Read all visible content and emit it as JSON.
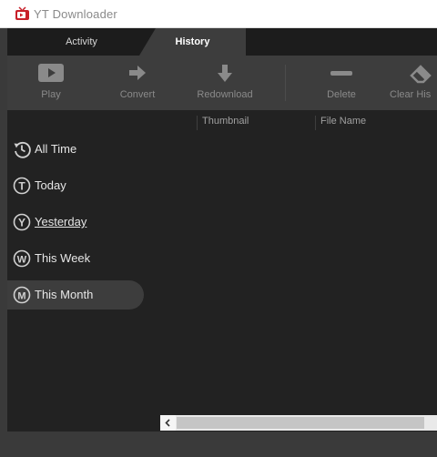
{
  "window": {
    "title": "YT Downloader",
    "icon": "tv-app-icon"
  },
  "tabs": [
    {
      "label": "Activity",
      "selected": false
    },
    {
      "label": "History",
      "selected": true
    }
  ],
  "toolbar": {
    "play": {
      "label": "Play",
      "icon": "play-icon"
    },
    "convert": {
      "label": "Convert",
      "icon": "arrow-right-icon"
    },
    "redownload": {
      "label": "Redownload",
      "icon": "arrow-down-icon"
    },
    "delete": {
      "label": "Delete",
      "icon": "minus-icon"
    },
    "clear_history": {
      "label": "Clear His",
      "icon": "eraser-icon"
    }
  },
  "sidebar": {
    "items": [
      {
        "label": "All Time",
        "icon": "clock-history-icon",
        "letter": "",
        "selected": false
      },
      {
        "label": "Today",
        "icon": "circle-letter-icon",
        "letter": "T",
        "selected": false
      },
      {
        "label": "Yesterday",
        "icon": "circle-letter-icon",
        "letter": "Y",
        "selected": false
      },
      {
        "label": "This Week",
        "icon": "circle-letter-icon",
        "letter": "W",
        "selected": false
      },
      {
        "label": "This Month",
        "icon": "circle-letter-icon",
        "letter": "M",
        "selected": true
      }
    ]
  },
  "table": {
    "columns": [
      "Thumbnail",
      "File Name"
    ]
  },
  "colors": {
    "tab_bar": "#1c1c1c",
    "toolbar": "#3d3d3d",
    "panel": "#222222",
    "selected_item": "#3d3d3d",
    "app_icon_red": "#c8202a"
  }
}
